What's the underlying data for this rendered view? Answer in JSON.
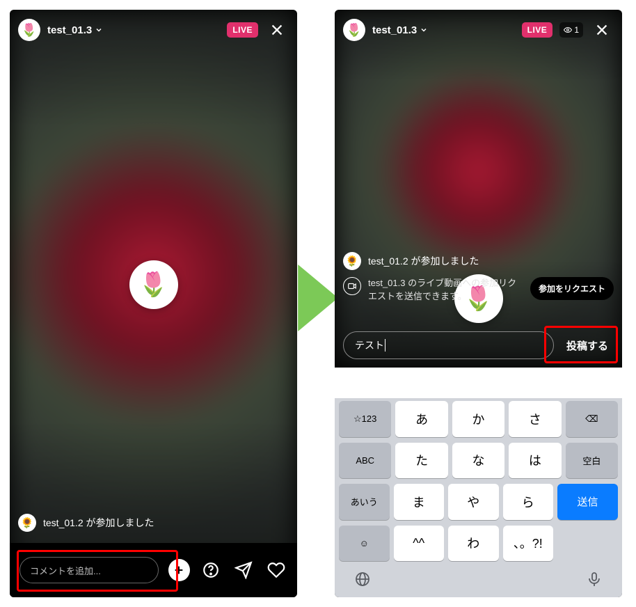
{
  "left": {
    "username": "test_01.3",
    "live_label": "LIVE",
    "avatar_glyph": "🌷",
    "center_glyph": "🌷",
    "joined_notice": {
      "avatar_glyph": "🌻",
      "text": "test_01.2 が参加しました"
    },
    "comment_placeholder": "コメントを追加..."
  },
  "right": {
    "username": "test_01.3",
    "live_label": "LIVE",
    "viewer_count": "1",
    "avatar_glyph": "🌷",
    "center_glyph": "🌷",
    "joined_notice": {
      "avatar_glyph": "🌻",
      "text": "test_01.2 が参加しました"
    },
    "request_notice": {
      "text": "test_01.3 のライブ動画への参加リクエストを送信できます。",
      "button_label": "参加をリクエスト"
    },
    "typed_text": "テスト",
    "post_label": "投稿する"
  },
  "keyboard": {
    "rows": [
      [
        "☆123",
        "あ",
        "か",
        "さ"
      ],
      [
        "ABC",
        "た",
        "な",
        "は",
        "空白"
      ],
      [
        "あいう",
        "ま",
        "や",
        "ら",
        "送信"
      ],
      [
        "☺︎",
        "^^",
        "わ",
        "、。?!"
      ]
    ],
    "backspace": "⌫"
  }
}
